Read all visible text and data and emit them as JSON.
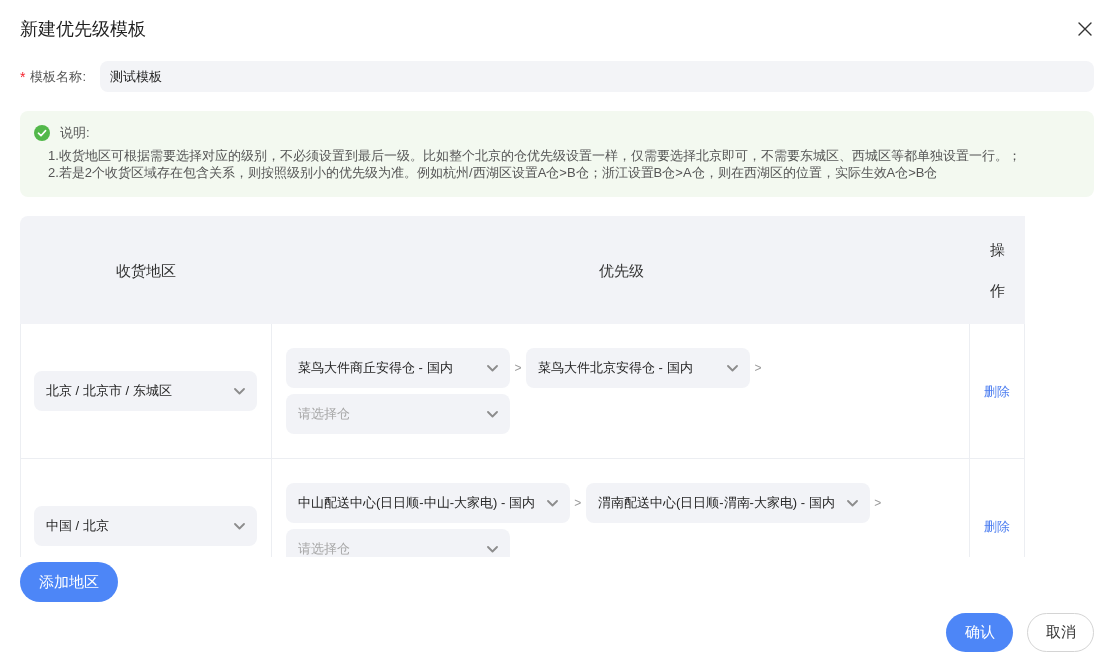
{
  "dialog": {
    "title": "新建优先级模板"
  },
  "name_field": {
    "required_mark": "*",
    "label": "模板名称:",
    "value": "测试模板"
  },
  "note": {
    "title": "说明:",
    "lines": [
      "1.收货地区可根据需要选择对应的级别，不必须设置到最后一级。比如整个北京的仓优先级设置一样，仅需要选择北京即可，不需要东城区、西城区等都单独设置一行。；",
      "2.若是2个收货区域存在包含关系，则按照级别小的优先级为准。例如杭州/西湖区设置A仓>B仓；浙江设置B仓>A仓，则在西湖区的位置，实际生效A仓>B仓"
    ]
  },
  "table": {
    "columns": [
      "收货地区",
      "优先级",
      "操作"
    ],
    "rows": [
      {
        "region": "北京 / 北京市 / 东城区",
        "warehouses": [
          {
            "value": "菜鸟大件商丘安得仓 - 国内",
            "separator": ">"
          },
          {
            "value": "菜鸟大件北京安得仓 - 国内",
            "separator": ">"
          }
        ],
        "next_select": {
          "placeholder": "请选择仓"
        },
        "action": "删除"
      },
      {
        "region": "中国 / 北京",
        "warehouses": [
          {
            "value": "中山配送中心(日日顺-中山-大家电) - 国内",
            "separator": ">"
          },
          {
            "value": "渭南配送中心(日日顺-渭南-大家电) - 国内",
            "separator": ">"
          }
        ],
        "next_select": {
          "placeholder": "请选择仓"
        },
        "action": "删除"
      }
    ]
  },
  "add_button": "添加地区",
  "footer": {
    "buttons": [
      {
        "label": "确认",
        "kind": "primary"
      },
      {
        "label": "取消",
        "kind": "default"
      }
    ]
  }
}
